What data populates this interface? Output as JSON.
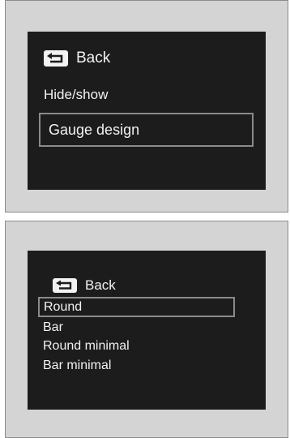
{
  "top_screen": {
    "back_label": "Back",
    "items": [
      "Hide/show",
      "Gauge design"
    ],
    "selected": "Gauge design"
  },
  "bottom_screen": {
    "back_label": "Back",
    "options": [
      "Round",
      "Bar",
      "Round minimal",
      "Bar minimal"
    ],
    "selected": "Round"
  },
  "colors": {
    "screen_background": "#1c1c1c",
    "text": "#f2f2f2",
    "selection_border": "#8a8a8a",
    "panel_background": "#d4d4d4"
  },
  "icons": [
    "back-arrow-icon"
  ]
}
